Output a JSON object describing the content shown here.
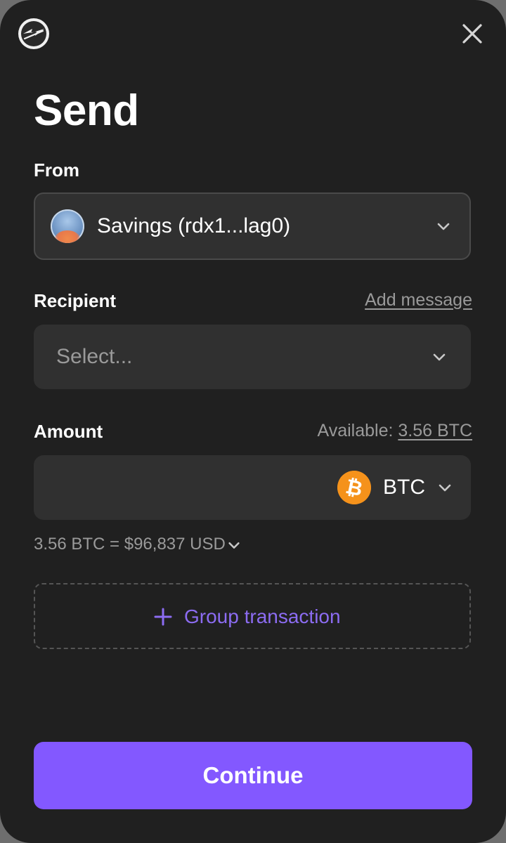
{
  "header": {
    "logo_icon": "wallet-logo-icon",
    "close_icon": "close-icon",
    "title": "Send"
  },
  "from": {
    "label": "From",
    "account": "Savings (rdx1...lag0)",
    "avatar_icon": "account-avatar"
  },
  "recipient": {
    "label": "Recipient",
    "add_message": "Add message",
    "placeholder": "Select..."
  },
  "amount": {
    "label": "Amount",
    "available_label": "Available:",
    "available_value": "3.56 BTC",
    "token": "BTC",
    "token_icon": "bitcoin-icon",
    "conversion": "3.56 BTC = $96,837 USD"
  },
  "group": {
    "label": "Group transaction"
  },
  "actions": {
    "continue": "Continue"
  },
  "colors": {
    "background": "#202020",
    "field": "#303030",
    "accent": "#8358ff",
    "accent_text": "#8c6cf2",
    "bitcoin": "#f5921b"
  }
}
